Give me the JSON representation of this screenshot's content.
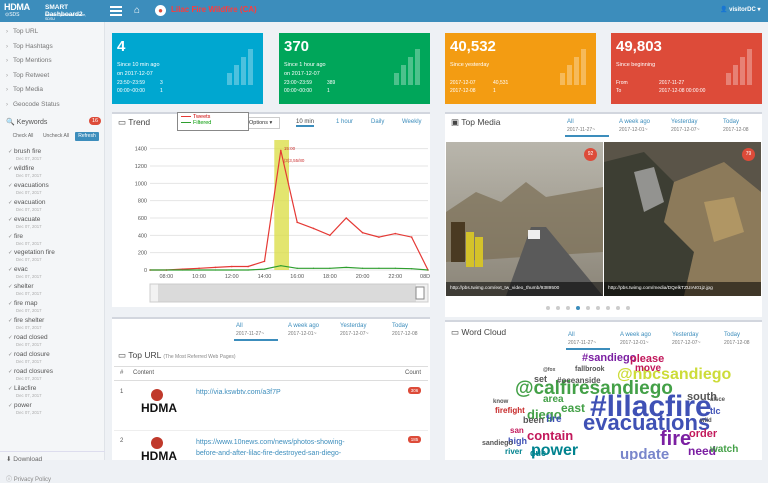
{
  "header": {
    "logo_main": "HDMA",
    "logo_sds": "⊙SDS",
    "app_name": "SMART Dashboard2",
    "app_sub": "Human Dynamics Centre, SDSU",
    "event_name": "Lilac Fire Wildfire (CA)",
    "user": "visitorDC"
  },
  "sidebar": {
    "nav": [
      "Top URL",
      "Top Hashtags",
      "Top Mentions",
      "Top Retweet",
      "Top Media",
      "Geocode Status"
    ],
    "keywords_label": "Keywords",
    "keywords_count": "16",
    "check_all": "Check All",
    "uncheck_all": "Uncheck All",
    "refresh": "Refresh",
    "keywords": [
      {
        "label": "brush fire",
        "date": "Dec 07, 2017"
      },
      {
        "label": "wildfire",
        "date": "Dec 07, 2017"
      },
      {
        "label": "evacuations",
        "date": "Dec 07, 2017"
      },
      {
        "label": "evacuation",
        "date": "Dec 07, 2017"
      },
      {
        "label": "evacuate",
        "date": "Dec 07, 2017"
      },
      {
        "label": "fire",
        "date": "Dec 07, 2017"
      },
      {
        "label": "vegetation fire",
        "date": "Dec 07, 2017"
      },
      {
        "label": "evac",
        "date": "Dec 07, 2017"
      },
      {
        "label": "shelter",
        "date": "Dec 07, 2017"
      },
      {
        "label": "fire map",
        "date": "Dec 07, 2017"
      },
      {
        "label": "fire shelter",
        "date": "Dec 07, 2017"
      },
      {
        "label": "road closed",
        "date": "Dec 07, 2017"
      },
      {
        "label": "road closure",
        "date": "Dec 07, 2017"
      },
      {
        "label": "road closures",
        "date": "Dec 07, 2017"
      },
      {
        "label": "Lilacfire",
        "date": "Dec 07, 2017"
      },
      {
        "label": "power",
        "date": "Dec 07, 2017"
      }
    ],
    "download": "Download",
    "privacy": "Privacy Policy"
  },
  "stats": [
    {
      "big": "4",
      "label": "Since 10 min ago",
      "date": "on 2017-12-07",
      "r1a": "23:50~23:59",
      "r1b": "3",
      "r2a": "00:00~00:00",
      "r2b": "1",
      "color": "#00a7d0"
    },
    {
      "big": "370",
      "label": "Since 1 hour ago",
      "date": "on 2017-12-07",
      "r1a": "23:00~23:59",
      "r1b": "389",
      "r2a": "00:00~00:00",
      "r2b": "1",
      "color": "#00a65a"
    },
    {
      "big": "40,532",
      "label": "Since yesterday",
      "date": "",
      "r1a": "2017-12-07",
      "r1b": "40,531",
      "r2a": "2017-12-08",
      "r2b": "1",
      "color": "#f39c12"
    },
    {
      "big": "49,803",
      "label": "Since beginning",
      "date": "",
      "r1a": "From",
      "r1b": "2017-11-27",
      "r2a": "To",
      "r2b": "2017-12-08 00:00:00",
      "color": "#dd4b39"
    }
  ],
  "trend": {
    "title": "Trend",
    "range_btn": "Options",
    "legend_tweets": "Tweets",
    "legend_filtered": "Filtered",
    "tabs": [
      "10 min",
      "1 hour",
      "Daily",
      "Weekly"
    ],
    "peak_time": "15:00",
    "peak_val": "(3)3,55/80"
  },
  "chart_data": {
    "type": "line",
    "x": [
      "07:00",
      "08:00",
      "09:00",
      "10:00",
      "11:00",
      "12:00",
      "13:00",
      "14:00",
      "15:00",
      "16:00",
      "17:00",
      "18:00",
      "19:00",
      "20:00",
      "21:00",
      "22:00",
      "23:00",
      "08Dec"
    ],
    "series": [
      {
        "name": "Tweets",
        "values": [
          0,
          0,
          10,
          20,
          30,
          40,
          40,
          100,
          1380,
          550,
          480,
          400,
          600,
          430,
          380,
          420,
          380,
          0
        ]
      },
      {
        "name": "Filtered",
        "values": [
          0,
          0,
          0,
          0,
          0,
          0,
          0,
          10,
          50,
          20,
          20,
          20,
          30,
          20,
          20,
          20,
          15,
          0
        ]
      }
    ],
    "ylim": [
      0,
      1500
    ],
    "yticks": [
      "0",
      "200",
      "400",
      "600",
      "800",
      "1000",
      "1200",
      "1400"
    ],
    "xticks": [
      "08:00",
      "10:00",
      "12:00",
      "14:00",
      "16:00",
      "18:00",
      "20:00",
      "22:00",
      "08Dec"
    ],
    "grid": true
  },
  "media": {
    "title": "Top Media",
    "tabs": [
      "All",
      "A week ago",
      "Yesterday",
      "Today"
    ],
    "subs": [
      "2017-11-27~",
      "2017-12-01~",
      "2017-12-07~",
      "2017-12-08"
    ],
    "items": [
      {
        "cap": "http://pbs.twimg.com/ext_tw_video_thumb/9389500",
        "badge": "92"
      },
      {
        "cap": "http://pbs.twimg.com/media/DQelkTZUIAI01jz.jpg",
        "badge": "79"
      }
    ]
  },
  "url": {
    "title": "Top URL",
    "hint": "(The Most Referred Web Pages)",
    "tabs": [
      "All",
      "A week ago",
      "Yesterday",
      "Today"
    ],
    "subs": [
      "2017-11-27~",
      "2017-12-01~",
      "2017-12-07~",
      "2017-12-08"
    ],
    "col_num": "#",
    "col_content": "Content",
    "col_count": "Count",
    "rows": [
      {
        "n": "1",
        "link": "http://via.kswbtv.com/a3f7P",
        "count": "306"
      },
      {
        "n": "2",
        "link": "https://www.10news.com/news/photos-showing-",
        "link2": "before-and-after-lilac-fire-destroyed-san-diego-",
        "count": "185"
      }
    ]
  },
  "wordcloud": {
    "title": "Word Cloud",
    "tabs": [
      "All",
      "A week ago",
      "Yesterday",
      "Today"
    ],
    "subs": [
      "2017-11-27~",
      "2017-12-01~",
      "2017-12-07~",
      "2017-12-08"
    ]
  }
}
